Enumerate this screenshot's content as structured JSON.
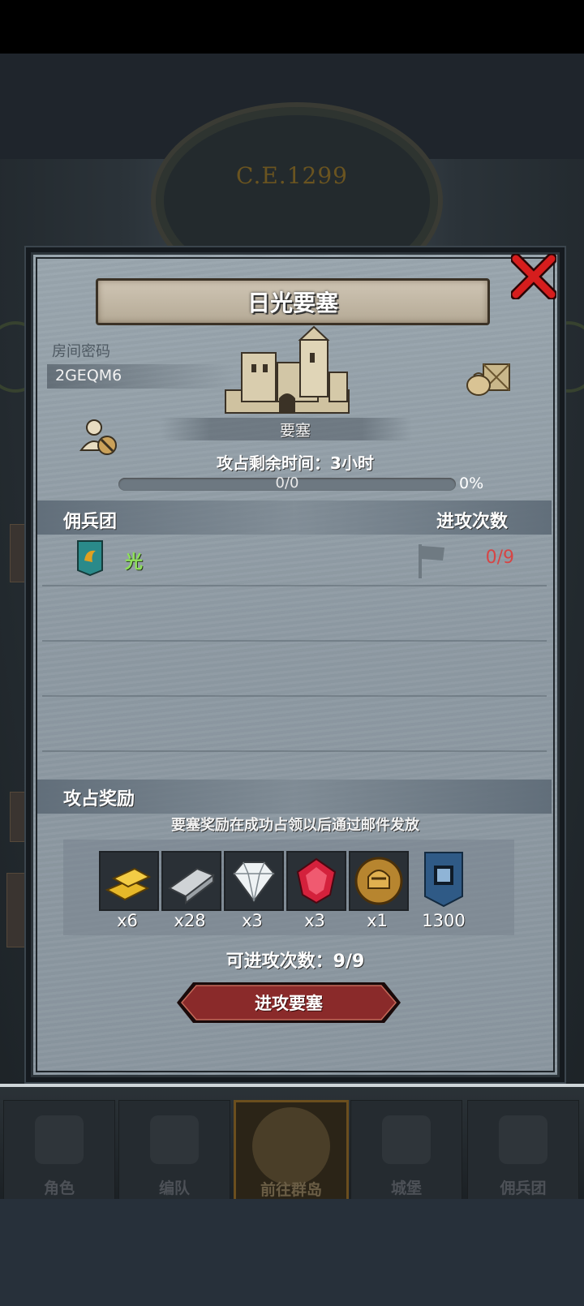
{
  "background": {
    "era_text": "C.E.1299"
  },
  "dialog": {
    "title": "日光要塞",
    "room_code_label": "房间密码",
    "room_code": "2GEQM6",
    "castle_label": "要塞",
    "attack_time": "攻占剩余时间：3小时",
    "progress": {
      "text": "0/0",
      "percent_text": "0%",
      "fraction": 0
    },
    "mercenary_header": "佣兵团",
    "attack_count_header": "进攻次数",
    "guilds": [
      {
        "name": "光",
        "attacks": "0/9"
      }
    ],
    "reward_header": "攻占奖励",
    "reward_note": "要塞奖励在成功占领以后通过邮件发放",
    "rewards": [
      {
        "icon": "gold-bars-icon",
        "count": "x6"
      },
      {
        "icon": "iron-ingot-icon",
        "count": "x28"
      },
      {
        "icon": "diamond-icon",
        "count": "x3"
      },
      {
        "icon": "ruby-icon",
        "count": "x3"
      },
      {
        "icon": "knight-helmet-medal-icon",
        "count": "x1"
      },
      {
        "icon": "fortress-banner-icon",
        "count": "1300"
      }
    ],
    "attacks_left": "可进攻次数：9/9",
    "attack_button": "进攻要塞"
  },
  "nav": {
    "items": [
      {
        "label": "角色",
        "icon": "knight-icon"
      },
      {
        "label": "编队",
        "icon": "helmet-icon"
      },
      {
        "label": "前往群岛",
        "icon": "compass-map-icon"
      },
      {
        "label": "城堡",
        "icon": "castle-icon"
      },
      {
        "label": "佣兵团",
        "icon": "mercenary-icon"
      }
    ]
  },
  "colors": {
    "accent_red": "#d64545",
    "guild_green": "#8ee05a",
    "button_red": "#8a2a2a"
  }
}
